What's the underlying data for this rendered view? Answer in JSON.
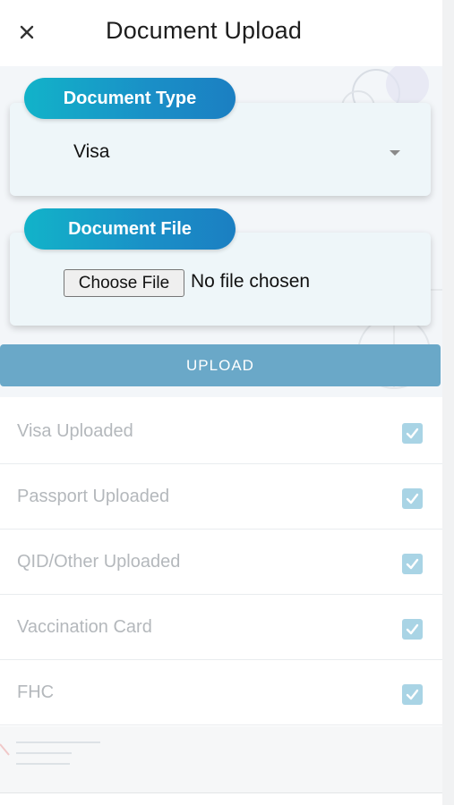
{
  "header": {
    "title": "Document Upload",
    "close_icon": "close-icon"
  },
  "document_type": {
    "label": "Document Type",
    "selected": "Visa",
    "caret_icon": "caret-down-icon"
  },
  "document_file": {
    "label": "Document File",
    "choose_button": "Choose File",
    "status": "No file chosen"
  },
  "upload": {
    "label": "UPLOAD"
  },
  "checklist": [
    {
      "label": "Visa Uploaded",
      "checked": true
    },
    {
      "label": "Passport Uploaded",
      "checked": true
    },
    {
      "label": "QID/Other Uploaded",
      "checked": true
    },
    {
      "label": "Vaccination Card",
      "checked": true
    },
    {
      "label": "FHC",
      "checked": true
    }
  ],
  "colors": {
    "pill_gradient_start": "#12b3c9",
    "pill_gradient_end": "#1b7fc2",
    "upload_button": "#6aa8c8",
    "checkbox_checked": "#a9d4e5",
    "disabled_text": "#b4b8bc"
  }
}
